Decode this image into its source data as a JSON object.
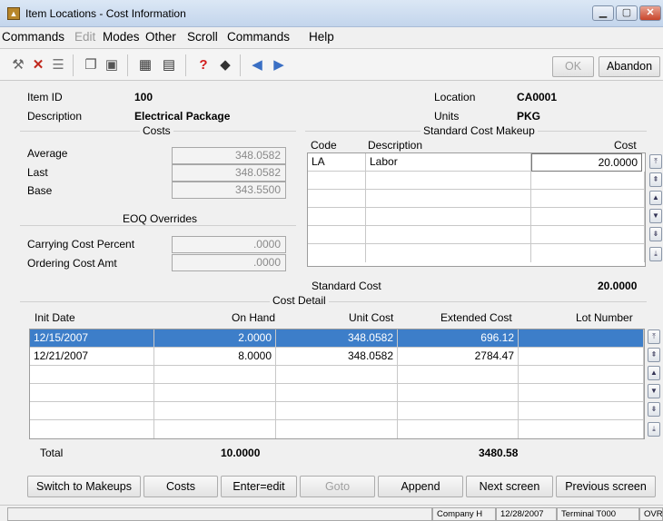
{
  "window": {
    "title": "Item Locations  - Cost Information"
  },
  "menu": [
    "Commands",
    "Edit",
    "Modes",
    "Other",
    "Scroll",
    "Commands",
    "Help"
  ],
  "toolbar": {
    "ok_label": "OK",
    "abandon_label": "Abandon"
  },
  "header": {
    "item_id_label": "Item ID",
    "item_id": "100",
    "description_label": "Description",
    "description": "Electrical Package",
    "location_label": "Location",
    "location": "CA0001",
    "units_label": "Units",
    "units": "PKG"
  },
  "costs": {
    "title": "Costs",
    "average_label": "Average",
    "average": "348.0582",
    "last_label": "Last",
    "last": "348.0582",
    "base_label": "Base",
    "base": "343.5500"
  },
  "eoq": {
    "title": "EOQ Overrides",
    "carrying_label": "Carrying Cost Percent",
    "carrying": ".0000",
    "ordering_label": "Ordering Cost Amt",
    "ordering": ".0000"
  },
  "makeup": {
    "title": "Standard Cost Makeup",
    "col_code": "Code",
    "col_description": "Description",
    "col_cost": "Cost",
    "rows": [
      {
        "code": "LA",
        "description": "Labor",
        "cost": "20.0000"
      }
    ],
    "standard_cost_label": "Standard Cost",
    "standard_cost": "20.0000"
  },
  "detail": {
    "title": "Cost Detail",
    "col_init_date": "Init Date",
    "col_on_hand": "On Hand",
    "col_unit_cost": "Unit Cost",
    "col_extended": "Extended Cost",
    "col_lot": "Lot Number",
    "rows": [
      {
        "date": "12/15/2007",
        "on_hand": "2.0000",
        "unit_cost": "348.0582",
        "extended": "696.12",
        "lot": ""
      },
      {
        "date": "12/21/2007",
        "on_hand": "8.0000",
        "unit_cost": "348.0582",
        "extended": "2784.47",
        "lot": ""
      }
    ],
    "total_label": "Total",
    "total_on_hand": "10.0000",
    "total_extended": "3480.58"
  },
  "buttons": {
    "switch": "Switch to Makeups",
    "costs": "Costs",
    "enter_edit": "Enter=edit",
    "goto": "Goto",
    "append": "Append",
    "next": "Next screen",
    "previous": "Previous screen"
  },
  "status": {
    "company": "Company H",
    "date": "12/28/2007",
    "terminal": "Terminal T000",
    "mode": "OVR"
  }
}
